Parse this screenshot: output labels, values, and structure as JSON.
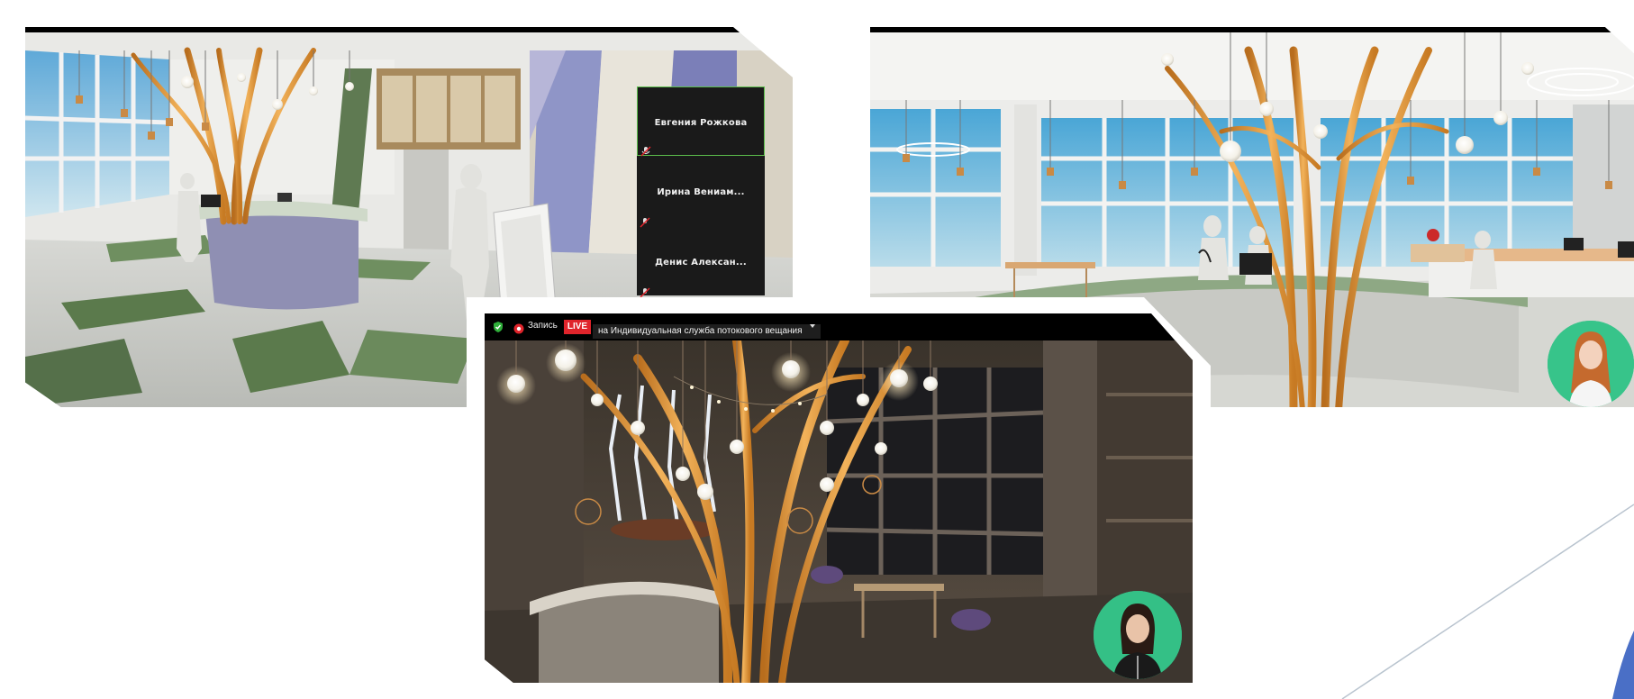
{
  "participants_panel": {
    "tiles": [
      {
        "name": "Евгения Рожкова",
        "active": true
      },
      {
        "name": "Ирина Вениам...",
        "active": false
      },
      {
        "name": "Денис Алексан...",
        "active": false
      }
    ]
  },
  "stream_bar": {
    "recording_label": "Запись",
    "live_label": "LIVE",
    "stream_target": "на Индивидуальная служба потокового вещания"
  },
  "colors": {
    "live_red": "#e0242b",
    "active_tile_border": "#5bbd4b",
    "secure_shield": "#2fae3a",
    "accent_blue": "#4a6fc6"
  }
}
